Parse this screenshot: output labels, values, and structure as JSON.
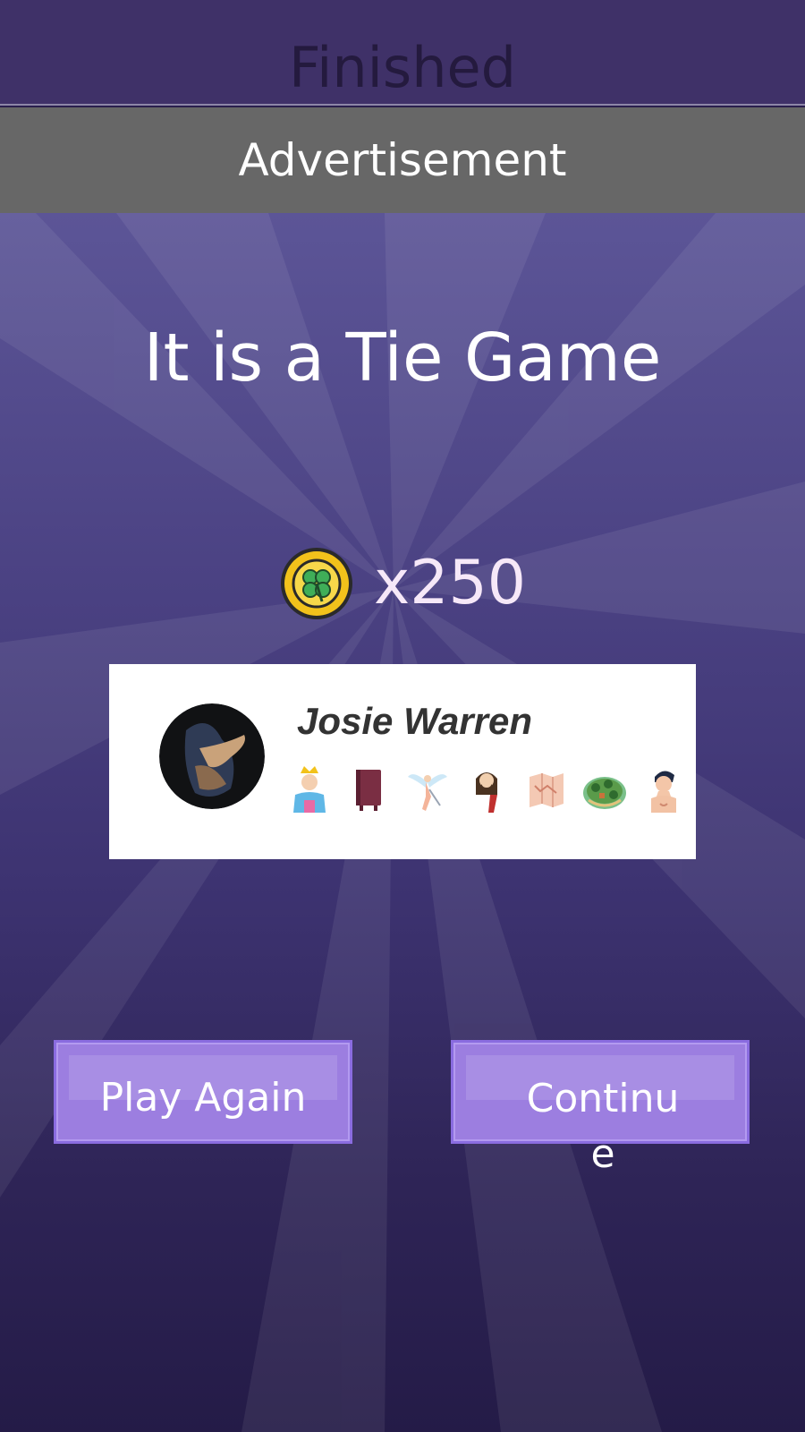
{
  "header": {
    "title": "Finished"
  },
  "ad": {
    "label": "Advertisement"
  },
  "result": {
    "headline": "It is a Tie Game"
  },
  "reward": {
    "icon": "clover-coin-icon",
    "amount": "x250"
  },
  "player": {
    "name": "Josie Warren",
    "badges": [
      "king-icon",
      "book-icon",
      "angel-icon",
      "jesus-icon",
      "scroll-map-icon",
      "island-map-icon",
      "man-icon"
    ]
  },
  "actions": {
    "play_again": "Play Again",
    "continue": "Continue"
  },
  "colors": {
    "button": "#9c7ee0",
    "ad_bar": "#676767",
    "header": "#3f3168"
  }
}
